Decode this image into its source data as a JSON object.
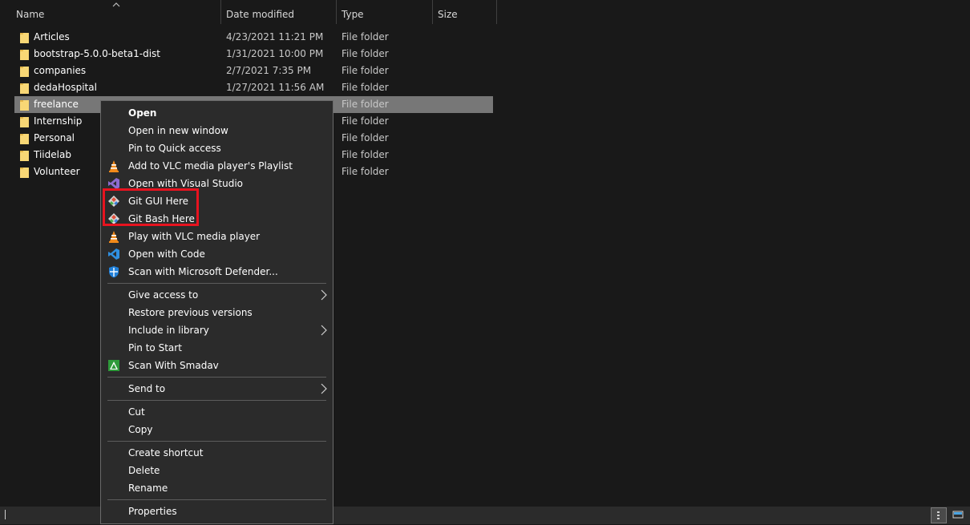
{
  "columns": {
    "name": "Name",
    "date_modified": "Date modified",
    "type": "Type",
    "size": "Size"
  },
  "files": [
    {
      "name": "Articles",
      "date": "4/23/2021 11:21 PM",
      "type": "File folder"
    },
    {
      "name": "bootstrap-5.0.0-beta1-dist",
      "date": "1/31/2021 10:00 PM",
      "type": "File folder"
    },
    {
      "name": "companies",
      "date": "2/7/2021 7:35 PM",
      "type": "File folder"
    },
    {
      "name": "dedaHospital",
      "date": "1/27/2021 11:56 AM",
      "type": "File folder"
    },
    {
      "name": "freelance",
      "date": "",
      "type": "File folder",
      "selected": true
    },
    {
      "name": "Internship",
      "date": "",
      "type": "File folder"
    },
    {
      "name": "Personal",
      "date": "",
      "type": "File folder"
    },
    {
      "name": "Tiidelab",
      "date": "",
      "type": "File folder"
    },
    {
      "name": "Volunteer",
      "date": "",
      "type": "File folder"
    }
  ],
  "context_menu": {
    "items": [
      {
        "label": "Open",
        "bold": true,
        "icon": ""
      },
      {
        "label": "Open in new window",
        "icon": ""
      },
      {
        "label": "Pin to Quick access",
        "icon": ""
      },
      {
        "label": "Add to VLC media player's Playlist",
        "icon": "vlc-icon"
      },
      {
        "label": "Open with Visual Studio",
        "icon": "visual-studio-icon"
      },
      {
        "label": "Git GUI Here",
        "icon": "git-icon"
      },
      {
        "label": "Git Bash Here",
        "icon": "git-icon"
      },
      {
        "label": "Play with VLC media player",
        "icon": "vlc-icon"
      },
      {
        "label": "Open with Code",
        "icon": "vscode-icon"
      },
      {
        "label": "Scan with Microsoft Defender...",
        "icon": "defender-icon"
      },
      {
        "label": "Give access to",
        "submenu": true
      },
      {
        "label": "Restore previous versions"
      },
      {
        "label": "Include in library",
        "submenu": true
      },
      {
        "label": "Pin to Start"
      },
      {
        "label": "Scan With Smadav",
        "icon": "smadav-icon"
      },
      {
        "label": "Send to",
        "submenu": true
      },
      {
        "label": "Cut"
      },
      {
        "label": "Copy"
      },
      {
        "label": "Create shortcut"
      },
      {
        "label": "Delete"
      },
      {
        "label": "Rename"
      },
      {
        "label": "Properties"
      }
    ]
  },
  "colors": {
    "background": "#191919",
    "menu_background": "#2b2b2b",
    "selection": "#777777",
    "highlight_box": "#e8131f",
    "folder": "#f8d775"
  }
}
